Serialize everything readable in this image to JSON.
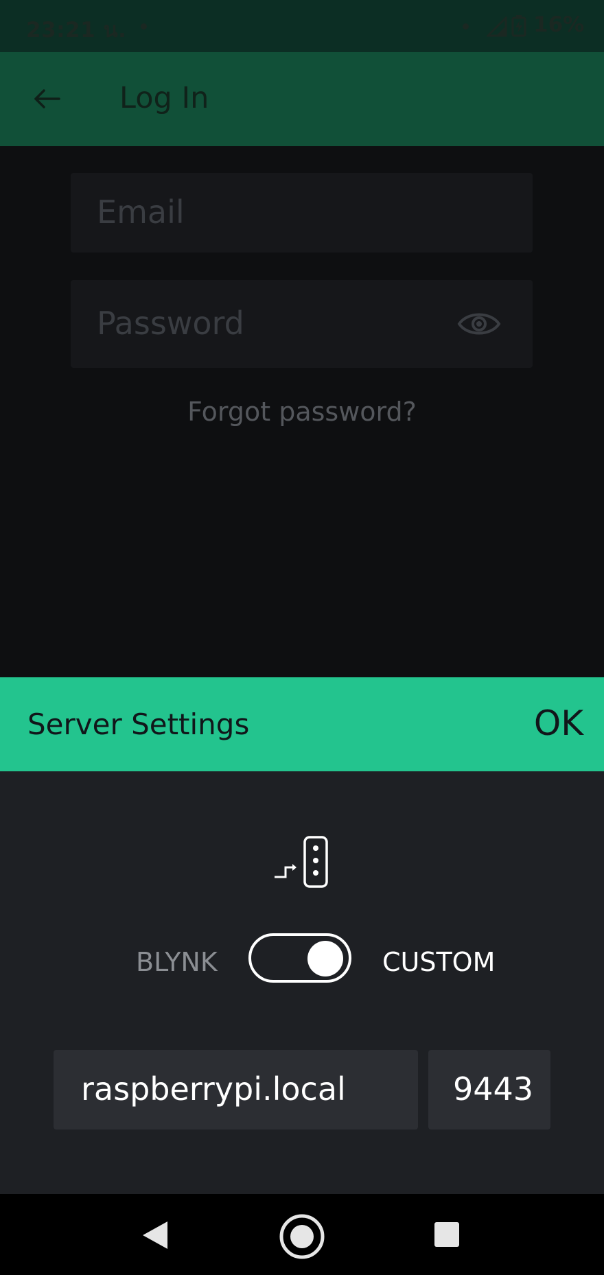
{
  "status_bar": {
    "time": "23:21 น.",
    "battery_percent": "16%",
    "icons": [
      "notification-dot-icon",
      "signal-icon",
      "battery-charging-icon"
    ]
  },
  "app_bar": {
    "title": "Log In",
    "back_icon": "arrow-left-icon"
  },
  "login_form": {
    "email_placeholder": "Email",
    "password_placeholder": "Password",
    "password_toggle_icon": "eye-icon",
    "forgot_password": "Forgot password?"
  },
  "server_settings": {
    "title": "Server Settings",
    "ok_label": "OK",
    "icon": "server-connection-icon",
    "toggle_left_label": "BLYNK",
    "toggle_right_label": "CUSTOM",
    "toggle_state": "custom",
    "host_value": "raspberrypi.local",
    "port_value": "9443"
  },
  "navigation_bar": {
    "icons": [
      "back-triangle-icon",
      "home-circle-icon",
      "recents-square-icon"
    ]
  },
  "colors": {
    "app_bar": "#115038",
    "status_bar": "#0c2e24",
    "accent": "#23c48e",
    "background": "#0e0f11",
    "sheet_background": "#1e2024"
  }
}
